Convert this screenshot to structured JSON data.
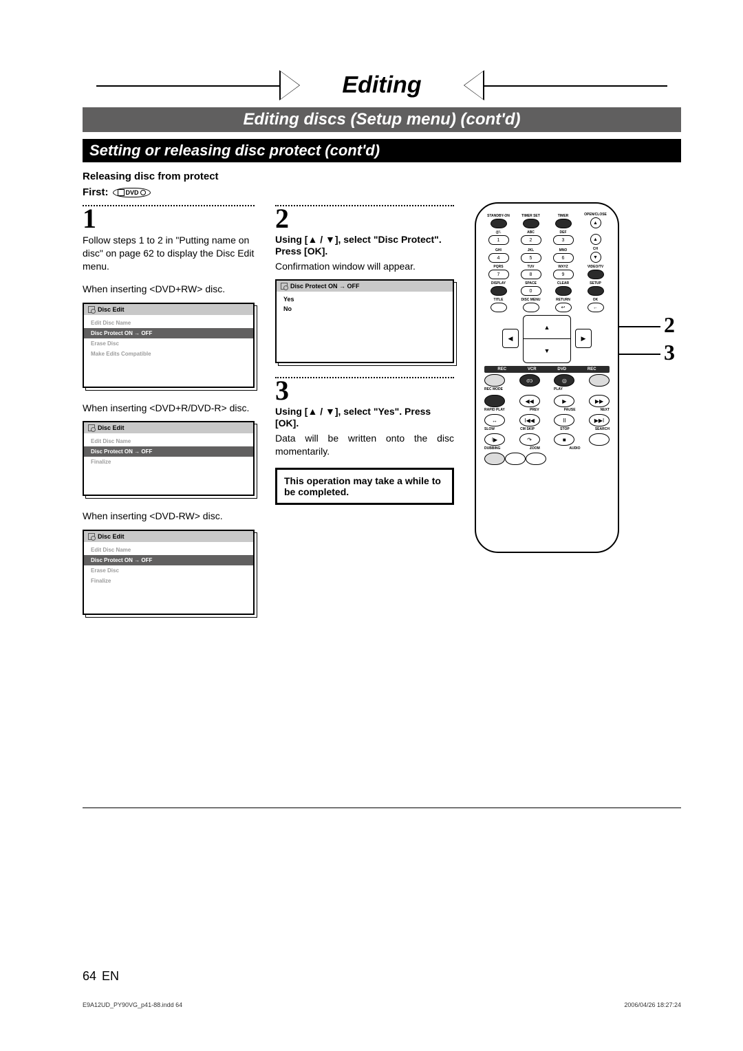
{
  "banner": {
    "title": "Editing"
  },
  "subtitle_band": "Editing discs (Setup menu) (cont'd)",
  "section_heading": "Setting or releasing disc protect (cont'd)",
  "releasing_heading": "Releasing disc from protect",
  "first_label": "First:",
  "dvd_badge": "DVD",
  "step1": {
    "num": "1",
    "body": "Follow steps 1 to 2 in \"Putting name on disc\" on page 62 to display the Disc Edit menu.",
    "caption_rw": "When inserting <DVD+RW> disc.",
    "caption_plusr": "When inserting <DVD+R/DVD-R> disc.",
    "caption_minusrw": "When inserting <DVD-RW> disc."
  },
  "menu": {
    "title": "Disc Edit",
    "items_rw": [
      "Edit Disc Name",
      "Disc Protect ON  →  OFF",
      "Erase Disc",
      "Make Edits Compatible"
    ],
    "items_plusr": [
      "Edit Disc Name",
      "Disc Protect ON  →  OFF",
      "Finalize"
    ],
    "items_minusrw": [
      "Edit Disc Name",
      "Disc Protect ON  →  OFF",
      "Erase Disc",
      "Finalize"
    ]
  },
  "step2": {
    "num": "2",
    "instr": "Using [▲ / ▼], select \"Disc Protect\". Press [OK].",
    "body": "Confirmation window will appear.",
    "confirm_title": "Disc Protect ON  →  OFF",
    "confirm_items": [
      "Yes",
      "No"
    ]
  },
  "step3": {
    "num": "3",
    "instr": "Using [▲ / ▼], select \"Yes\". Press [OK].",
    "body": "Data will be written onto the disc momentarily.",
    "note": "This operation may take a while to be completed."
  },
  "remote": {
    "row1": [
      "STANDBY-ON",
      "TIMER SET",
      "TIMER",
      "OPEN/CLOSE"
    ],
    "row2": [
      "@!.",
      "ABC",
      "DEF",
      ""
    ],
    "num_row2": [
      "1",
      "2",
      "3"
    ],
    "row3": [
      "GHI",
      "JKL",
      "MNO",
      "CH"
    ],
    "num_row3": [
      "4",
      "5",
      "6"
    ],
    "row4": [
      "PQRS",
      "TUV",
      "WXYZ",
      "VIDEO/TV"
    ],
    "num_row4": [
      "7",
      "8",
      "9"
    ],
    "row5": [
      "DISPLAY",
      "SPACE",
      "CLEAR",
      "SETUP"
    ],
    "num_row5": [
      "•",
      "0",
      "•"
    ],
    "row6": [
      "TITLE",
      "DISC MENU",
      "RETURN",
      "OK"
    ],
    "rec_band": [
      "REC",
      "VCR",
      "DVD",
      "REC"
    ],
    "rec_mode": "REC MODE",
    "play": "PLAY",
    "transport1": [
      "RAPID PLAY",
      "PREV",
      "PAUSE",
      "NEXT"
    ],
    "transport2": [
      "SLOW",
      "CM SKIP",
      "STOP",
      "SEARCH"
    ],
    "transport3": [
      "DUBBING",
      "ZOOM",
      "AUDIO",
      ""
    ]
  },
  "callouts": {
    "two": "2",
    "three": "3"
  },
  "footer": {
    "page": "64",
    "lang": "EN"
  },
  "indd": {
    "left": "E9A12UD_PY90VG_p41-88.indd   64",
    "right": "2006/04/26   18:27:24"
  }
}
